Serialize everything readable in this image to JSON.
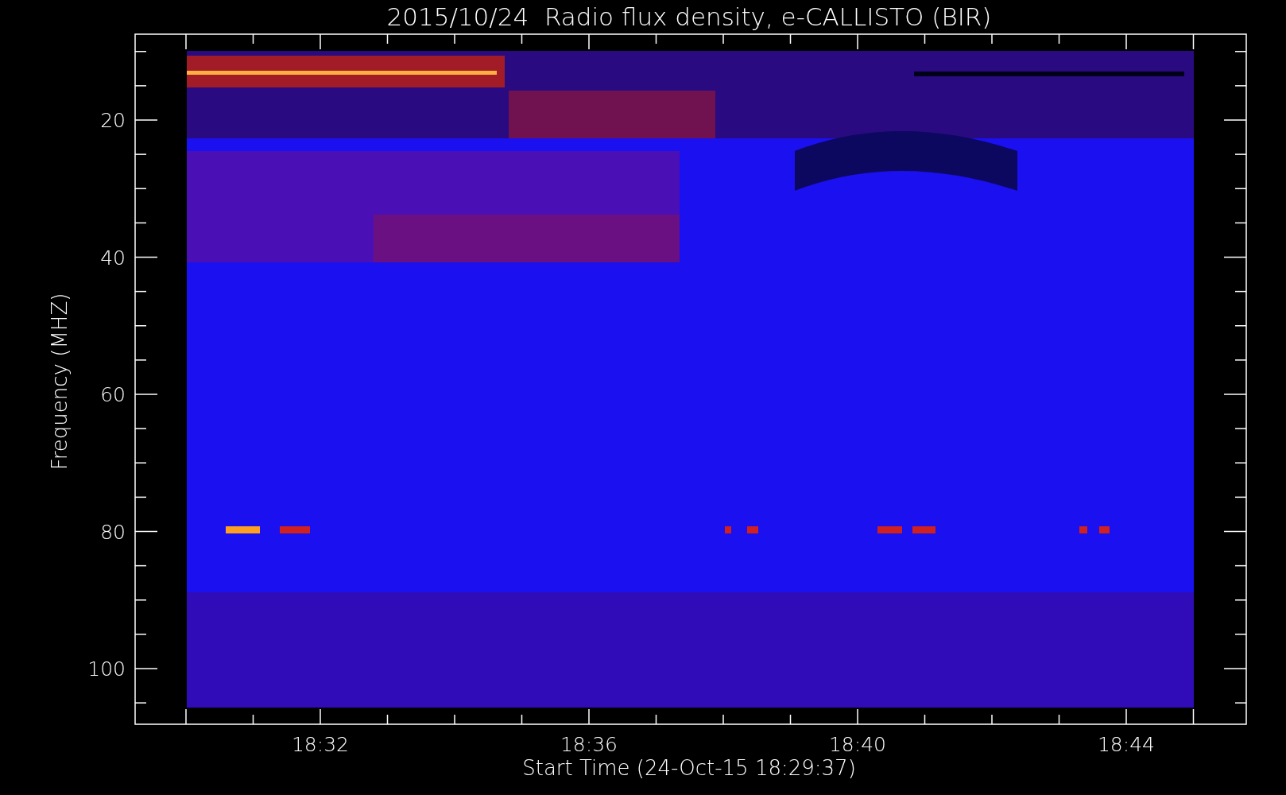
{
  "plot": {
    "title": "2015/10/24  Radio flux density, e-CALLISTO (BIR)",
    "y_axis": {
      "label": "Frequency (MHZ)",
      "ticks": [
        "20",
        "40",
        "60",
        "80",
        "100"
      ]
    },
    "x_axis": {
      "label": "Start Time (24-Oct-15 18:29:37)",
      "ticks": [
        "18:32",
        "18:36",
        "18:40",
        "18:44"
      ]
    }
  }
}
